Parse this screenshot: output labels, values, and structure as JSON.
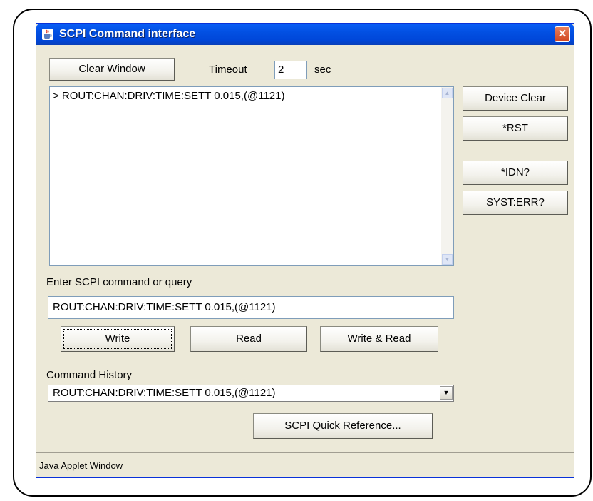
{
  "window": {
    "title": "SCPI Command interface",
    "close_glyph": "✕"
  },
  "toolbar": {
    "clear_window_label": "Clear Window",
    "timeout_label": "Timeout",
    "timeout_value": "2",
    "timeout_unit": "sec"
  },
  "output": {
    "lines": [
      "> ROUT:CHAN:DRIV:TIME:SETT 0.015,(@1121)"
    ]
  },
  "side_buttons": {
    "device_clear": "Device Clear",
    "rst": "*RST",
    "idn": "*IDN?",
    "syst_err": "SYST:ERR?"
  },
  "command": {
    "label": "Enter SCPI command or query",
    "value": "ROUT:CHAN:DRIV:TIME:SETT 0.015,(@1121)",
    "write_label": "Write",
    "read_label": "Read",
    "write_read_label": "Write & Read"
  },
  "history": {
    "label": "Command History",
    "selected": "ROUT:CHAN:DRIV:TIME:SETT 0.015,(@1121)"
  },
  "quick_ref_label": "SCPI Quick Reference...",
  "status": "Java Applet Window",
  "icons": {
    "app": "java-cup-icon",
    "close": "close-icon",
    "scroll_up": "scroll-up-icon",
    "scroll_down": "scroll-down-icon",
    "dropdown": "chevron-down-icon"
  },
  "colors": {
    "titlebar": "#0250e2",
    "window_bg": "#ece9d8",
    "close_button": "#d2461f"
  }
}
